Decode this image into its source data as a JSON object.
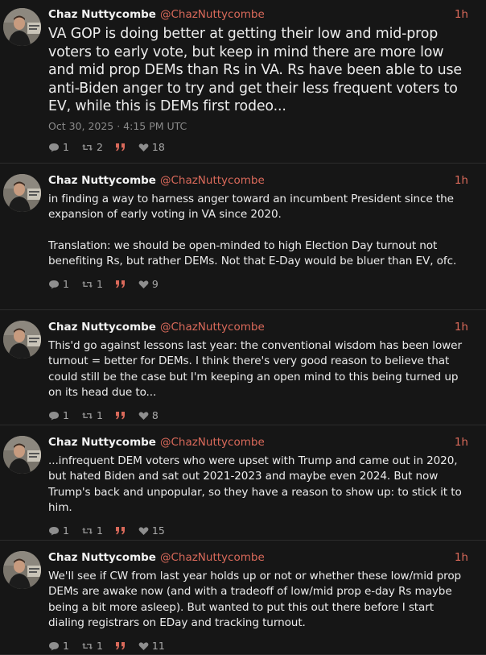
{
  "colors": {
    "background": "#161616",
    "accent": "#d9695a",
    "text": "#ececec",
    "muted": "#8a8a8a"
  },
  "tweets": [
    {
      "name": "Chaz Nuttycombe",
      "handle": "@ChazNuttycombe",
      "time": "1h",
      "text": "VA GOP is doing better at getting their low and mid-prop voters to early vote, but keep in mind there are more low and mid prop DEMs than Rs in VA. Rs have been able to use anti-Biden anger to try and get their less frequent voters to EV, while this is DEMs first rodeo...",
      "date": "Oct 30, 2025 · 4:15 PM UTC",
      "replies": "1",
      "retweets": "2",
      "quotes_icon": "quote-icon",
      "likes": "18"
    },
    {
      "name": "Chaz Nuttycombe",
      "handle": "@ChazNuttycombe",
      "time": "1h",
      "text": "in finding a way to harness anger toward an incumbent President since the expansion of early voting in VA since 2020.\n\nTranslation: we should be open-minded to high Election Day turnout not benefiting Rs, but rather DEMs. Not that E-Day would be bluer than EV, ofc.",
      "replies": "1",
      "retweets": "1",
      "quotes_icon": "quote-icon",
      "likes": "9"
    },
    {
      "name": "Chaz Nuttycombe",
      "handle": "@ChazNuttycombe",
      "time": "1h",
      "text": "This'd go against lessons last year: the conventional wisdom has been lower turnout = better for DEMs. I think there's very good reason to believe that could still be the case but I'm keeping an open mind to this being turned up on its head due to...",
      "replies": "1",
      "retweets": "1",
      "quotes_icon": "quote-icon",
      "likes": "8"
    },
    {
      "name": "Chaz Nuttycombe",
      "handle": "@ChazNuttycombe",
      "time": "1h",
      "text": "...infrequent DEM voters who were upset with Trump and came out in 2020, but hated Biden and sat out 2021-2023 and maybe even 2024. But now Trump's back and unpopular, so they have a reason to show up: to stick it to him.",
      "replies": "1",
      "retweets": "1",
      "quotes_icon": "quote-icon",
      "likes": "15"
    },
    {
      "name": "Chaz Nuttycombe",
      "handle": "@ChazNuttycombe",
      "time": "1h",
      "text": "We'll see if CW from last year holds up or not or whether these low/mid prop DEMs are awake now (and with a tradeoff of low/mid prop e-day Rs maybe being a bit more asleep). But wanted to put this out there before I start dialing registrars on EDay and tracking turnout.",
      "replies": "1",
      "retweets": "1",
      "quotes_icon": "quote-icon",
      "likes": "11"
    }
  ]
}
